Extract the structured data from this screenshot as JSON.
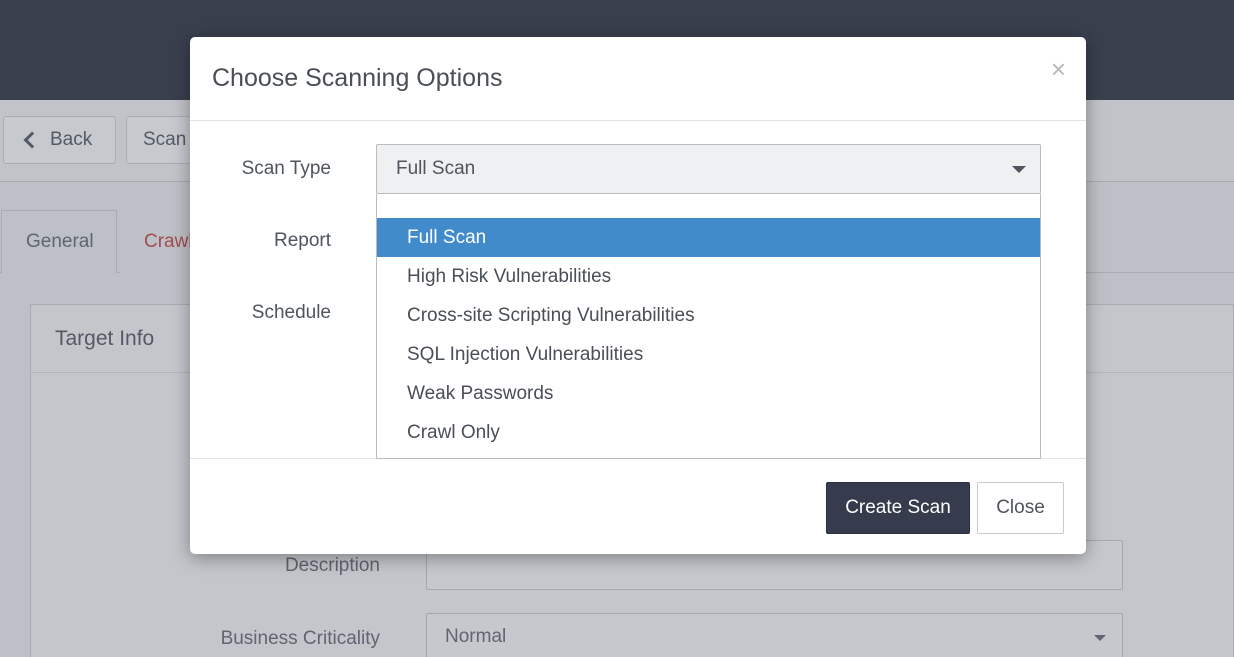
{
  "background": {
    "toolbar": {
      "back_label": "Back",
      "scan_label": "Scan"
    },
    "tabs": [
      "General",
      "Crawl"
    ],
    "panel": {
      "title": "Target Info"
    },
    "fields": {
      "description_label": "Description",
      "business_criticality_label": "Business Criticality",
      "business_criticality_value": "Normal"
    }
  },
  "modal": {
    "title": "Choose Scanning Options",
    "close_glyph": "×",
    "scan_type_label": "Scan Type",
    "report_label": "Report",
    "schedule_label": "Schedule",
    "scan_type_selected": "Full Scan",
    "scan_type_options": [
      "Full Scan",
      "High Risk Vulnerabilities",
      "Cross-site Scripting Vulnerabilities",
      "SQL Injection Vulnerabilities",
      "Weak Passwords",
      "Crawl Only"
    ],
    "create_button": "Create Scan",
    "close_button": "Close"
  },
  "colors": {
    "topbar": "#3a3f4e",
    "primary_button": "#363b4d",
    "selected_option": "#428bca",
    "tab_warning_text": "#c0504d"
  }
}
